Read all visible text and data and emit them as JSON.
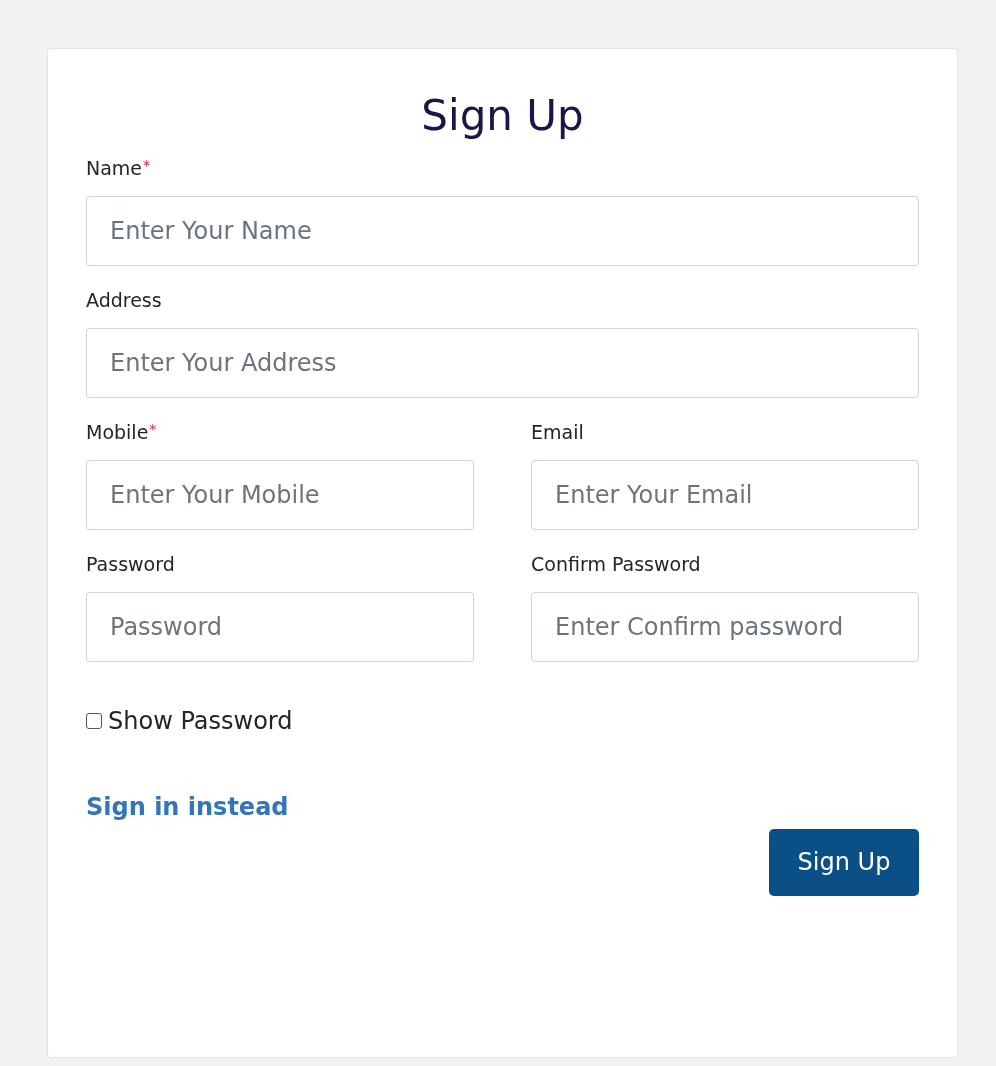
{
  "form": {
    "title": "Sign Up",
    "rows": [
      [
        {
          "label": "Name",
          "required_mark": "*",
          "placeholder": "Enter Your Name"
        }
      ],
      [
        {
          "label": "Address",
          "placeholder": "Enter Your Address"
        }
      ],
      [
        {
          "label": "Mobile",
          "required_mark": "*",
          "placeholder": "Enter Your Mobile"
        },
        {
          "label": "Email",
          "placeholder": "Enter Your Email"
        }
      ],
      [
        {
          "label": "Password",
          "placeholder": "Password"
        },
        {
          "label": "Confirm Password",
          "placeholder": "Enter Confirm password"
        }
      ]
    ],
    "show_password": {
      "label": "Show Password",
      "checked": false
    },
    "sign_in_link": "Sign in instead",
    "submit_button": "Sign Up"
  }
}
